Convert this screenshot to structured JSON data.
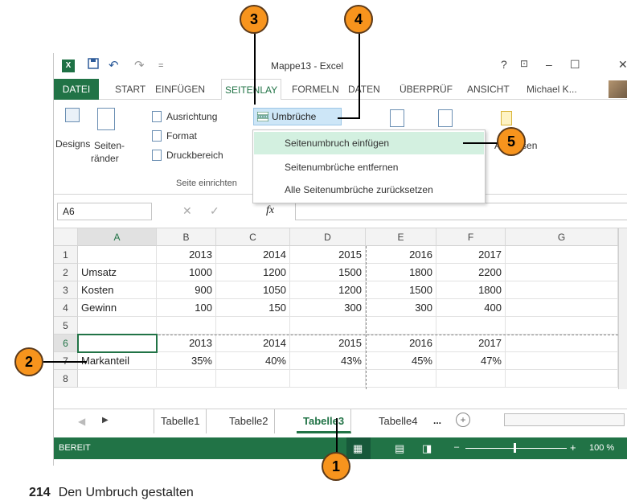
{
  "titlebar": {
    "title": "Mappe13 - Excel",
    "help": "?",
    "min": "–",
    "max": "☐",
    "close": "✕"
  },
  "tabs": [
    "DATEI",
    "START",
    "EINFÜGEN",
    "SEITENLAY",
    "FORMELN",
    "DATEN",
    "ÜBERPRÜF",
    "ANSICHT"
  ],
  "user": "Michael K...",
  "ribbon": {
    "designs": "Designs",
    "seitenraender": [
      "Seiten-",
      "ränder"
    ],
    "ausrichtung": "Ausrichtung",
    "format": "Format",
    "druckbereich": "Druckbereich",
    "umbrueche": "Umbrüche",
    "group_label": "Seite einrichten",
    "anpassen": "Anpassen"
  },
  "dropdown": [
    "Seitenumbruch einfügen",
    "Seitenumbrüche entfernen",
    "Alle Seitenumbrüche zurücksetzen"
  ],
  "formula": {
    "namebox": "A6",
    "fx": "fx"
  },
  "columns": [
    "A",
    "B",
    "C",
    "D",
    "E",
    "F",
    "G"
  ],
  "rows": [
    [
      "1",
      "",
      "2013",
      "2014",
      "2015",
      "2016",
      "2017",
      ""
    ],
    [
      "2",
      "Umsatz",
      "1000",
      "1200",
      "1500",
      "1800",
      "2200",
      ""
    ],
    [
      "3",
      "Kosten",
      "900",
      "1050",
      "1200",
      "1500",
      "1800",
      ""
    ],
    [
      "4",
      "Gewinn",
      "100",
      "150",
      "300",
      "300",
      "400",
      ""
    ],
    [
      "5",
      "",
      "",
      "",
      "",
      "",
      "",
      ""
    ],
    [
      "6",
      "",
      "2013",
      "2014",
      "2015",
      "2016",
      "2017",
      ""
    ],
    [
      "7",
      "Markanteil",
      "35%",
      "40%",
      "43%",
      "45%",
      "47%",
      ""
    ],
    [
      "8",
      "",
      "",
      "",
      "",
      "",
      "",
      ""
    ]
  ],
  "sheets": [
    "Tabelle1",
    "Tabelle2",
    "Tabelle3",
    "Tabelle4"
  ],
  "sheets_more": "...",
  "status": {
    "ready": "BEREIT",
    "zoom": "100 %"
  },
  "callouts": [
    "1",
    "2",
    "3",
    "4",
    "5"
  ],
  "footer": {
    "page": "214",
    "title": "Den Umbruch gestalten"
  },
  "colors": {
    "excel_green": "#217346",
    "callout": "#f7941d",
    "highlight": "#d3f0e0"
  }
}
